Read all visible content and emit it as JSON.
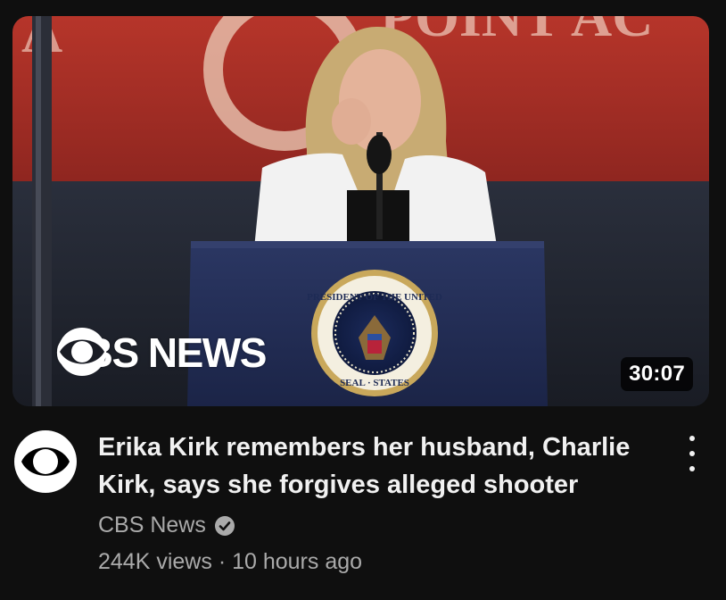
{
  "video": {
    "thumbnail": {
      "brand_overlay": "CBS NEWS",
      "duration": "30:07",
      "background_banner_text": "POINT AC",
      "podium_seal_top": "PRESIDENT OF THE UNITED",
      "podium_seal_bottom": "SEAL · STATES"
    },
    "title": "Erika Kirk remembers her husband, Charlie Kirk, says she forgives alleged shooter",
    "channel": {
      "name": "CBS News",
      "verified": true,
      "avatar_icon": "cbs-eye-logo"
    },
    "views": "244K views",
    "separator": "·",
    "published": "10 hours ago",
    "menu_icon": "more-vert-icon"
  },
  "colors": {
    "background": "#0f0f0f",
    "title_text": "#f1f1f1",
    "secondary_text": "#aaaaaa"
  }
}
